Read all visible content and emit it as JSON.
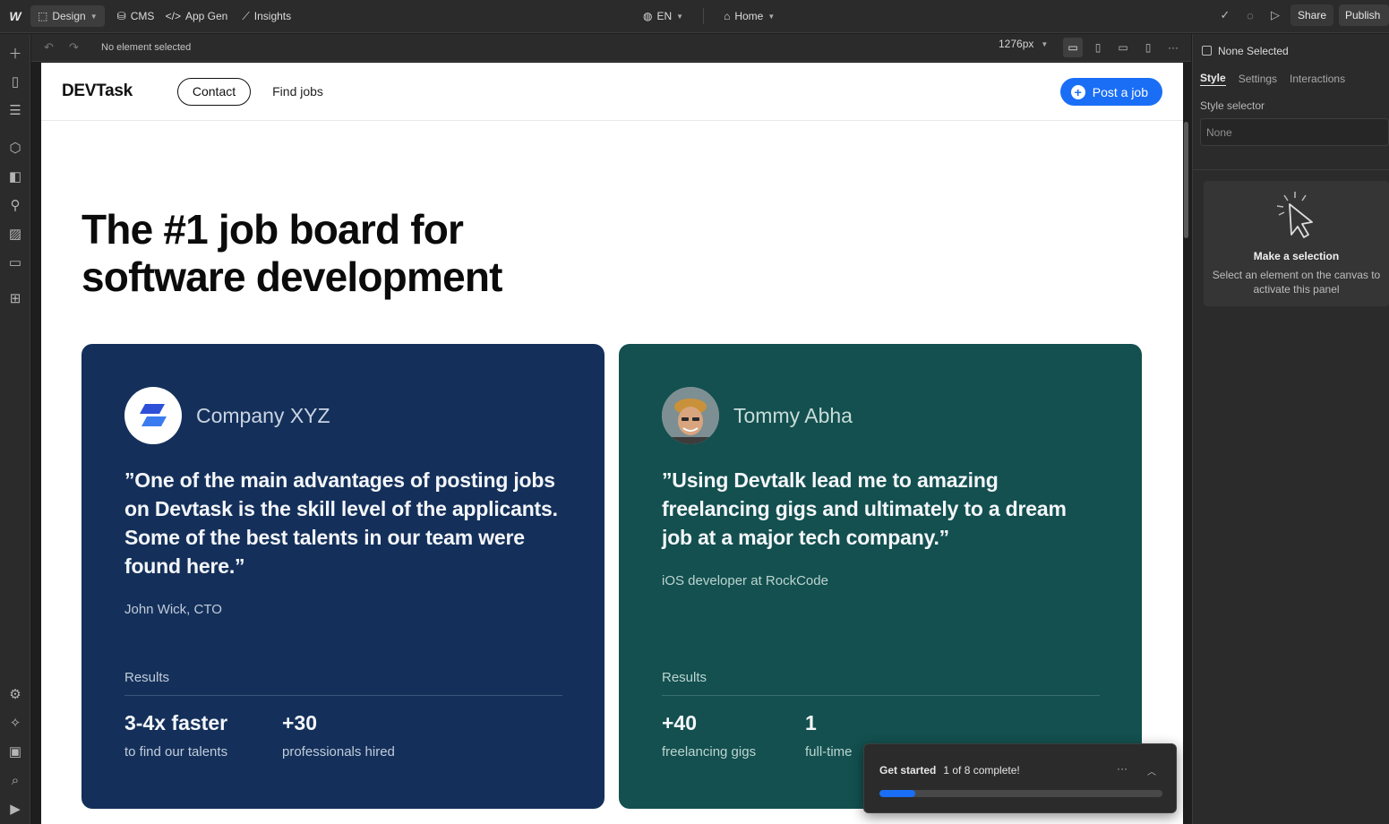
{
  "topbar": {
    "design": "Design",
    "cms": "CMS",
    "app_gen": "App Gen",
    "insights": "Insights",
    "locale": "EN",
    "page": "Home",
    "share": "Share",
    "publish": "Publish"
  },
  "canvas_bar": {
    "selection": "No element selected",
    "breakpoint": "1276px"
  },
  "site": {
    "brand": "DEVTask",
    "nav_contact": "Contact",
    "nav_find": "Find jobs",
    "post_button": "Post a job",
    "hero_line1": "The #1 job board for",
    "hero_line2": "software development",
    "cards": [
      {
        "name": "Company XYZ",
        "quote": "”One of the main advantages of posting jobs on Devtask is the skill level of the applicants. Some of the best talents in our team were found here.”",
        "attribution": "John Wick, CTO",
        "results_label": "Results",
        "stats": [
          {
            "value": "3-4x faster",
            "label": "to find our talents"
          },
          {
            "value": "+30",
            "label": "professionals hired"
          }
        ]
      },
      {
        "name": "Tommy Abha",
        "quote": "”Using Devtalk lead me to amazing freelancing gigs and ultimately to a dream job at a major tech company.”",
        "attribution": "iOS developer at RockCode",
        "results_label": "Results",
        "stats": [
          {
            "value": "+40",
            "label": "freelancing gigs"
          },
          {
            "value": "1",
            "label": "full-time"
          }
        ]
      }
    ]
  },
  "get_started": {
    "title": "Get started",
    "progress_text": "1 of 8 complete!",
    "progress": 0.125
  },
  "right_panel": {
    "none_selected": "None Selected",
    "tabs": [
      "Style",
      "Settings",
      "Interactions"
    ],
    "style_selector_label": "Style selector",
    "style_selector_value": "None",
    "empty_title": "Make a selection",
    "empty_text": "Select an element on the canvas to activate this panel"
  },
  "colors": {
    "accent": "#1a6ef5",
    "card_blue": "#14305a",
    "card_green": "#13504f"
  }
}
